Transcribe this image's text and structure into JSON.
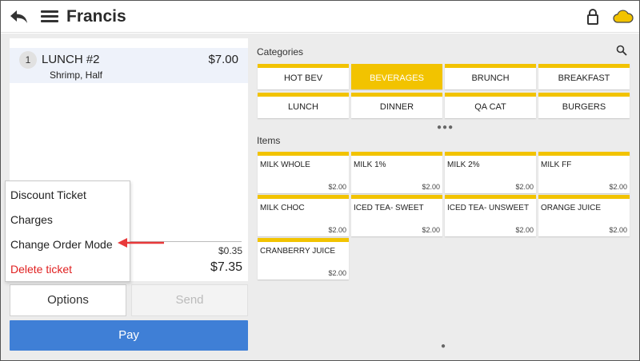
{
  "header": {
    "title": "Francis",
    "back_icon": "back-arrow-icon",
    "menu_icon": "hamburger-menu-icon",
    "lock_icon": "lock-icon",
    "cloud_icon": "cloud-icon",
    "cloud_color": "#f2c300"
  },
  "ticket": {
    "items": [
      {
        "qty": "1",
        "name": "LUNCH #2",
        "price": "$7.00",
        "modifiers": "Shrimp, Half"
      }
    ],
    "tax": "$0.35",
    "total": "$7.35"
  },
  "options_menu": {
    "items": [
      {
        "label": "Discount Ticket"
      },
      {
        "label": "Charges"
      },
      {
        "label": "Change Order Mode"
      },
      {
        "label": "Delete ticket"
      }
    ],
    "danger_color": "#e02020"
  },
  "actions": {
    "options_label": "Options",
    "send_label": "Send",
    "pay_label": "Pay",
    "pay_color": "#3f7fd6"
  },
  "categories": {
    "label": "Categories",
    "accent_color": "#f2c300",
    "tiles": [
      {
        "label": "HOT BEV",
        "active": false
      },
      {
        "label": "BEVERAGES",
        "active": true
      },
      {
        "label": "BRUNCH",
        "active": false
      },
      {
        "label": "BREAKFAST",
        "active": false
      },
      {
        "label": "LUNCH",
        "active": false
      },
      {
        "label": "DINNER",
        "active": false
      },
      {
        "label": "QA CAT",
        "active": false
      },
      {
        "label": "BURGERS",
        "active": false
      }
    ]
  },
  "items": {
    "label": "Items",
    "tiles": [
      {
        "name": "MILK WHOLE",
        "price": "$2.00"
      },
      {
        "name": "MILK 1%",
        "price": "$2.00"
      },
      {
        "name": "MILK 2%",
        "price": "$2.00"
      },
      {
        "name": "MILK FF",
        "price": "$2.00"
      },
      {
        "name": "MILK CHOC",
        "price": "$2.00"
      },
      {
        "name": "ICED TEA- SWEET",
        "price": "$2.00"
      },
      {
        "name": "ICED TEA- UNSWEET",
        "price": "$2.00"
      },
      {
        "name": "ORANGE JUICE",
        "price": "$2.00"
      },
      {
        "name": "CRANBERRY JUICE",
        "price": "$2.00"
      }
    ]
  }
}
